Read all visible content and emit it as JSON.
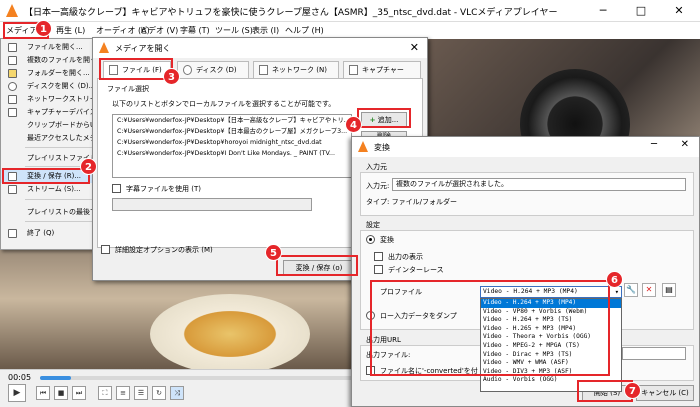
{
  "window": {
    "title": "【日本一高級なクレープ】キャビアやトリュフを豪快に使うクレープ屋さん【ASMR】_35_ntsc_dvd.dat - VLCメディアプレイヤー",
    "minimize": "─",
    "maximize": "□",
    "close": "✕"
  },
  "menubar": {
    "media": "メディア(M)",
    "playback": "再生 (L)",
    "audio": "オーディオ (A)",
    "video": "ビデオ (V)",
    "subtitle": "字幕 (T)",
    "tools": "ツール (S)",
    "view": "表示 (I)",
    "help": "ヘルプ (H)"
  },
  "media_menu": [
    "ファイルを開く...",
    "複数のファイルを開く...",
    "フォルダーを開く...",
    "ディスクを開く (D)...",
    "ネットワークストリームを開く...",
    "キャプチャーデバイスを開く...",
    "クリップボードからURLを開く",
    "最近アクセスしたメディア",
    "プレイリストファイルを保存...",
    "変換 / 保存 (R)...",
    "ストリーム (S)...",
    "プレイリストの最後で終了",
    "終了 (Q)"
  ],
  "open_dialog": {
    "title": "メディアを開く",
    "tabs": [
      "ファイル (F)",
      "ディスク (D)",
      "ネットワーク (N)",
      "キャプチャー"
    ],
    "group_label": "ファイル選択",
    "instruction": "以下のリストとボタンでローカルファイルを選択することが可能です。",
    "files": [
      "C:¥Users¥wonderfox-JP¥Desktop¥【日本一高級なクレープ】キャビアやトリ...",
      "C:¥Users¥wonderfox-JP¥Desktop¥【日本最古のクレープ屋】メガクレープ3...",
      "C:¥Users¥wonderfox-JP¥Desktop¥horoyoi midnight_ntsc_dvd.dat",
      "C:¥Users¥wonderfox-JP¥Desktop¥I Don't Like Mondays. _ PAINT (TV..."
    ],
    "add_button": "追加...",
    "remove_button": "削除",
    "subtitle_checkbox": "字幕ファイルを使用 (T)",
    "advanced_checkbox": "詳細設定オプションの表示 (M)",
    "convert_save_button": "変換 / 保存 (o)"
  },
  "convert_dialog": {
    "title": "変換",
    "source_section": "入力元",
    "source_label": "入力元:",
    "source_value": "複数のファイルが選択されました。",
    "type_label": "タイプ: ファイル/フォルダー",
    "settings_section": "設定",
    "convert_radio": "変換",
    "output_display_checkbox": "出力の表示",
    "deinterlace_checkbox": "デインターレース",
    "profile_label": "プロファイル",
    "profile_selected": "Video - H.264 + MP3 (MP4)",
    "dump_radio": "ロー入力データをダンプ",
    "output_section": "出力用URL",
    "output_file_label": "出力ファイル:",
    "filename_checkbox": "ファイル名に'-converted'を付",
    "start_button": "開始 (S)",
    "cancel_button": "キャンセル (C)",
    "profiles": [
      "Video - H.264 + MP3 (MP4)",
      "Video - VP80 + Vorbis (Webm)",
      "Video - H.264 + MP3 (TS)",
      "Video - H.265 + MP3 (MP4)",
      "Video - Theora + Vorbis (OGG)",
      "Video - MPEG-2 + MPGA (TS)",
      "Video - Dirac + MP3 (TS)",
      "Video - WMV + WMA (ASF)",
      "Video - DIV3 + MP3 (ASF)",
      "Audio - Vorbis (OGG)"
    ]
  },
  "controls": {
    "time": "00:05",
    "progress": 0.05
  },
  "callouts": [
    "1",
    "2",
    "3",
    "4",
    "5",
    "6",
    "7"
  ],
  "colors": {
    "accent_red": "#e5262a",
    "selection_blue": "#0078d7",
    "vlc_orange": "#f48120"
  }
}
